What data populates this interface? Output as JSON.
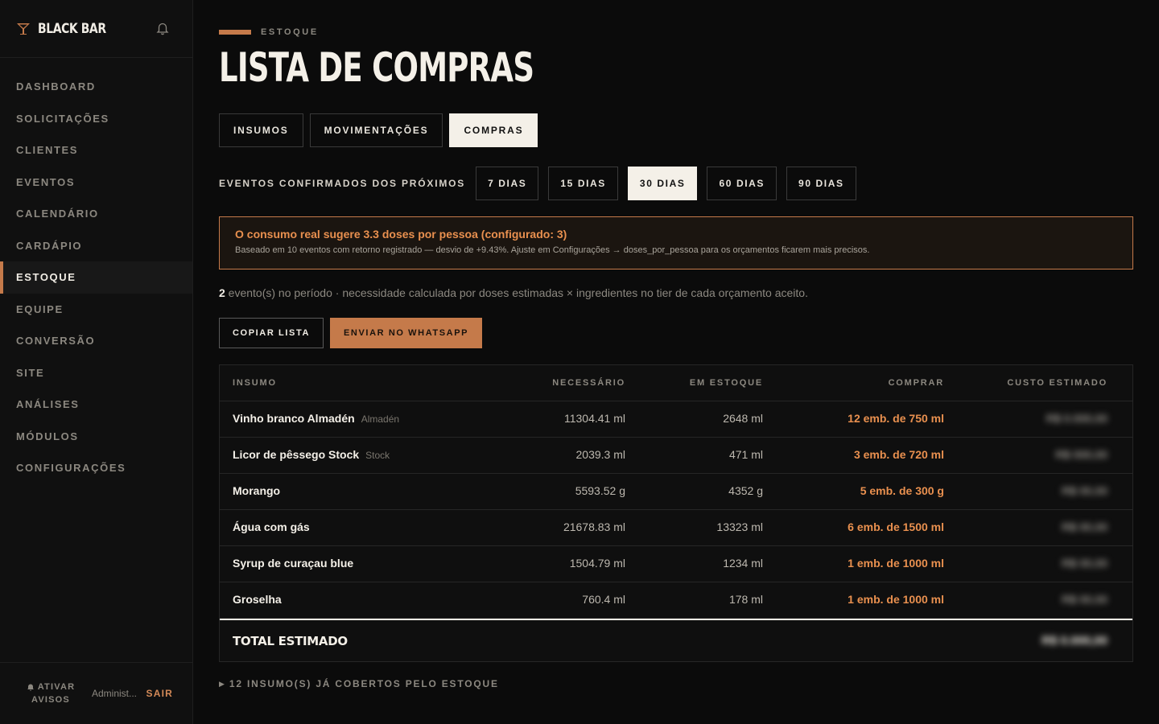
{
  "brand": {
    "name": "BLACK BAR"
  },
  "sidebar": {
    "items": [
      {
        "label": "DASHBOARD"
      },
      {
        "label": "SOLICITAÇÕES"
      },
      {
        "label": "CLIENTES"
      },
      {
        "label": "EVENTOS"
      },
      {
        "label": "CALENDÁRIO"
      },
      {
        "label": "CARDÁPIO"
      },
      {
        "label": "ESTOQUE"
      },
      {
        "label": "EQUIPE"
      },
      {
        "label": "CONVERSÃO"
      },
      {
        "label": "SITE"
      },
      {
        "label": "ANÁLISES"
      },
      {
        "label": "MÓDULOS"
      },
      {
        "label": "CONFIGURAÇÕES"
      }
    ],
    "active_index": 6,
    "footer": {
      "notify_line1": "ATIVAR",
      "notify_line2": "AVISOS",
      "user": "Administ...",
      "logout": "SAIR"
    }
  },
  "header": {
    "eyebrow": "ESTOQUE",
    "title": "LISTA DE COMPRAS"
  },
  "tabs": [
    {
      "label": "INSUMOS",
      "active": false
    },
    {
      "label": "MOVIMENTAÇÕES",
      "active": false
    },
    {
      "label": "COMPRAS",
      "active": true
    }
  ],
  "period": {
    "label": "EVENTOS CONFIRMADOS DOS PRÓXIMOS",
    "options": [
      {
        "label": "7 DIAS",
        "active": false
      },
      {
        "label": "15 DIAS",
        "active": false
      },
      {
        "label": "30 DIAS",
        "active": true
      },
      {
        "label": "60 DIAS",
        "active": false
      },
      {
        "label": "90 DIAS",
        "active": false
      }
    ]
  },
  "alert": {
    "title": "O consumo real sugere 3.3 doses por pessoa (configurado: 3)",
    "text": "Baseado em 10 eventos com retorno registrado — desvio de +9.43%. Ajuste em Configurações → doses_por_pessoa para os orçamentos ficarem mais precisos."
  },
  "summary": {
    "count": "2",
    "text": " evento(s) no período · necessidade calculada por doses estimadas × ingredientes no tier de cada orçamento aceito."
  },
  "actions": {
    "copy": "COPIAR LISTA",
    "whatsapp": "ENVIAR NO WHATSAPP"
  },
  "table": {
    "headers": [
      "INSUMO",
      "NECESSÁRIO",
      "EM ESTOQUE",
      "COMPRAR",
      "CUSTO ESTIMADO"
    ],
    "rows": [
      {
        "name": "Vinho branco Almadén",
        "brand": "Almadén",
        "needed": "11304.41 ml",
        "stock": "2648 ml",
        "buy": "12 emb. de 750 ml",
        "cost": "R$ 0.000,00"
      },
      {
        "name": "Licor de pêssego Stock",
        "brand": "Stock",
        "needed": "2039.3 ml",
        "stock": "471 ml",
        "buy": "3 emb. de 720 ml",
        "cost": "R$ 000,00"
      },
      {
        "name": "Morango",
        "brand": "",
        "needed": "5593.52 g",
        "stock": "4352 g",
        "buy": "5 emb. de 300 g",
        "cost": "R$ 00,00"
      },
      {
        "name": "Água com gás",
        "brand": "",
        "needed": "21678.83 ml",
        "stock": "13323 ml",
        "buy": "6 emb. de 1500 ml",
        "cost": "R$ 00,00"
      },
      {
        "name": "Syrup de curaçau blue",
        "brand": "",
        "needed": "1504.79 ml",
        "stock": "1234 ml",
        "buy": "1 emb. de 1000 ml",
        "cost": "R$ 00,00"
      },
      {
        "name": "Groselha",
        "brand": "",
        "needed": "760.4 ml",
        "stock": "178 ml",
        "buy": "1 emb. de 1000 ml",
        "cost": "R$ 00,00"
      }
    ],
    "total_label": "TOTAL ESTIMADO",
    "total_value": "R$ 0.000,00"
  },
  "covered": {
    "text": "12 INSUMO(S) JÁ COBERTOS PELO ESTOQUE"
  },
  "colors": {
    "accent": "#c57a4a",
    "accent_text": "#e9904f",
    "background": "#0b0b0b",
    "sidebar": "#101010"
  }
}
